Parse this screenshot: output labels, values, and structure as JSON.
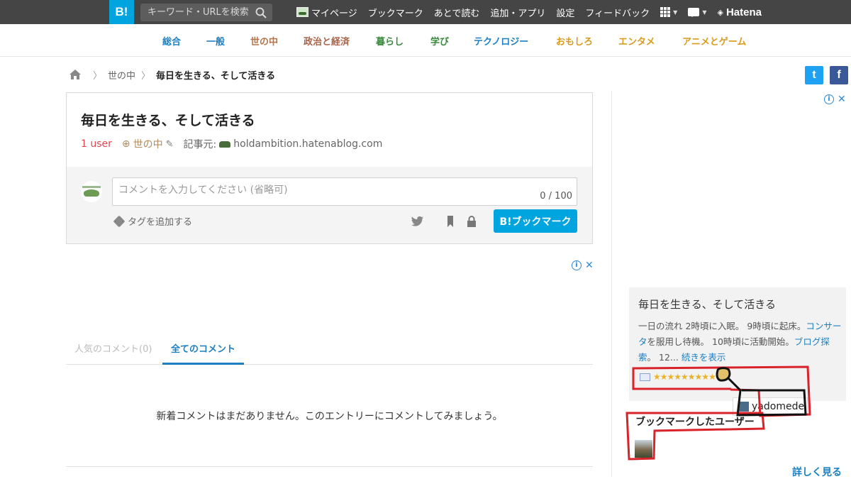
{
  "topbar": {
    "logo": "B!",
    "search_placeholder": "キーワード・URLを検索",
    "nav": [
      "マイページ",
      "ブックマーク",
      "あとで読む",
      "追加・アプリ",
      "設定",
      "フィードバック"
    ],
    "brand": "Hatena",
    "colors": {
      "bar": "#454545",
      "logo": "#00a4de"
    }
  },
  "categories": [
    {
      "label": "総合",
      "color": "#1c7fc2"
    },
    {
      "label": "一般",
      "color": "#1c7fc2"
    },
    {
      "label": "世の中",
      "color": "#b5744a"
    },
    {
      "label": "政治と経済",
      "color": "#a9644a"
    },
    {
      "label": "暮らし",
      "color": "#3b8a3e"
    },
    {
      "label": "学び",
      "color": "#3b8a3e"
    },
    {
      "label": "テクノロジー",
      "color": "#1c7fc2"
    },
    {
      "label": "おもしろ",
      "color": "#d99a1c"
    },
    {
      "label": "エンタメ",
      "color": "#d99a1c"
    },
    {
      "label": "アニメとゲーム",
      "color": "#d99a1c"
    }
  ],
  "breadcrumb": {
    "parent": "世の中",
    "current": "毎日を生きる、そして活きる"
  },
  "entry": {
    "title": "毎日を生きる、そして活きる",
    "users": "1 user",
    "category": "世の中",
    "source_label": "記事元:",
    "source": "holdambition.hatenablog.com"
  },
  "comment": {
    "placeholder": "コメントを入力してください (省略可)",
    "counter": "0 / 100",
    "tag_add": "タグを追加する",
    "bookmark_button": "B!ブックマーク"
  },
  "tabs": {
    "popular": "人気のコメント(0)",
    "all": "全てのコメント"
  },
  "empty_message": "新着コメントはまだありません。このエントリーにコメントしてみましょう。",
  "sidebar": {
    "title": "毎日を生きる、そして活きる",
    "excerpt_1": "一日の流れ 2時頃に入眠。 9時頃に起床。",
    "excerpt_link_1": "コンサータ",
    "excerpt_2": "を服用し待機。 10時頃に活動開始。",
    "excerpt_link_2": "ブログ探索",
    "excerpt_3": "。 12...",
    "more": "続きを表示",
    "stars": "★★★★★★★★★",
    "username": "yadomede",
    "bookmarked_users": "ブックマークしたユーザー",
    "detail": "詳しく見る"
  },
  "social": {
    "twitter": "t",
    "facebook": "f",
    "twitter_color": "#1da1f2",
    "facebook_color": "#3b5998"
  }
}
